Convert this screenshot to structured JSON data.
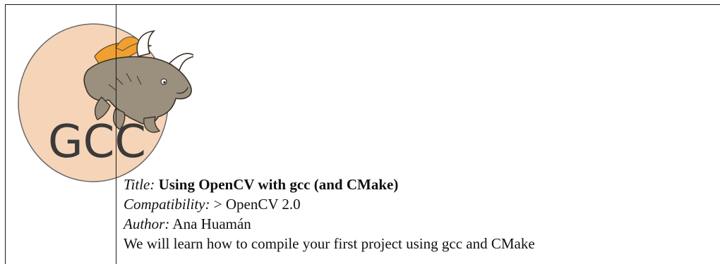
{
  "logo": {
    "text": "GCC",
    "icon": "gcc-gnu-logo"
  },
  "meta": {
    "title_label": "Title:",
    "title": "Using OpenCV with gcc (and CMake)",
    "compat_label": "Compatibility:",
    "compat_value": "> OpenCV 2.0",
    "author_label": "Author:",
    "author": "Ana Huamán",
    "description": "We will learn how to compile your first project using gcc and CMake"
  },
  "colors": {
    "egg_fill": "#f6d4b8",
    "egg_stroke": "#6a6a6a",
    "horn": "#f0a030",
    "gnu_body": "#9b8f7e",
    "logo_text": "#3a3a3a"
  }
}
